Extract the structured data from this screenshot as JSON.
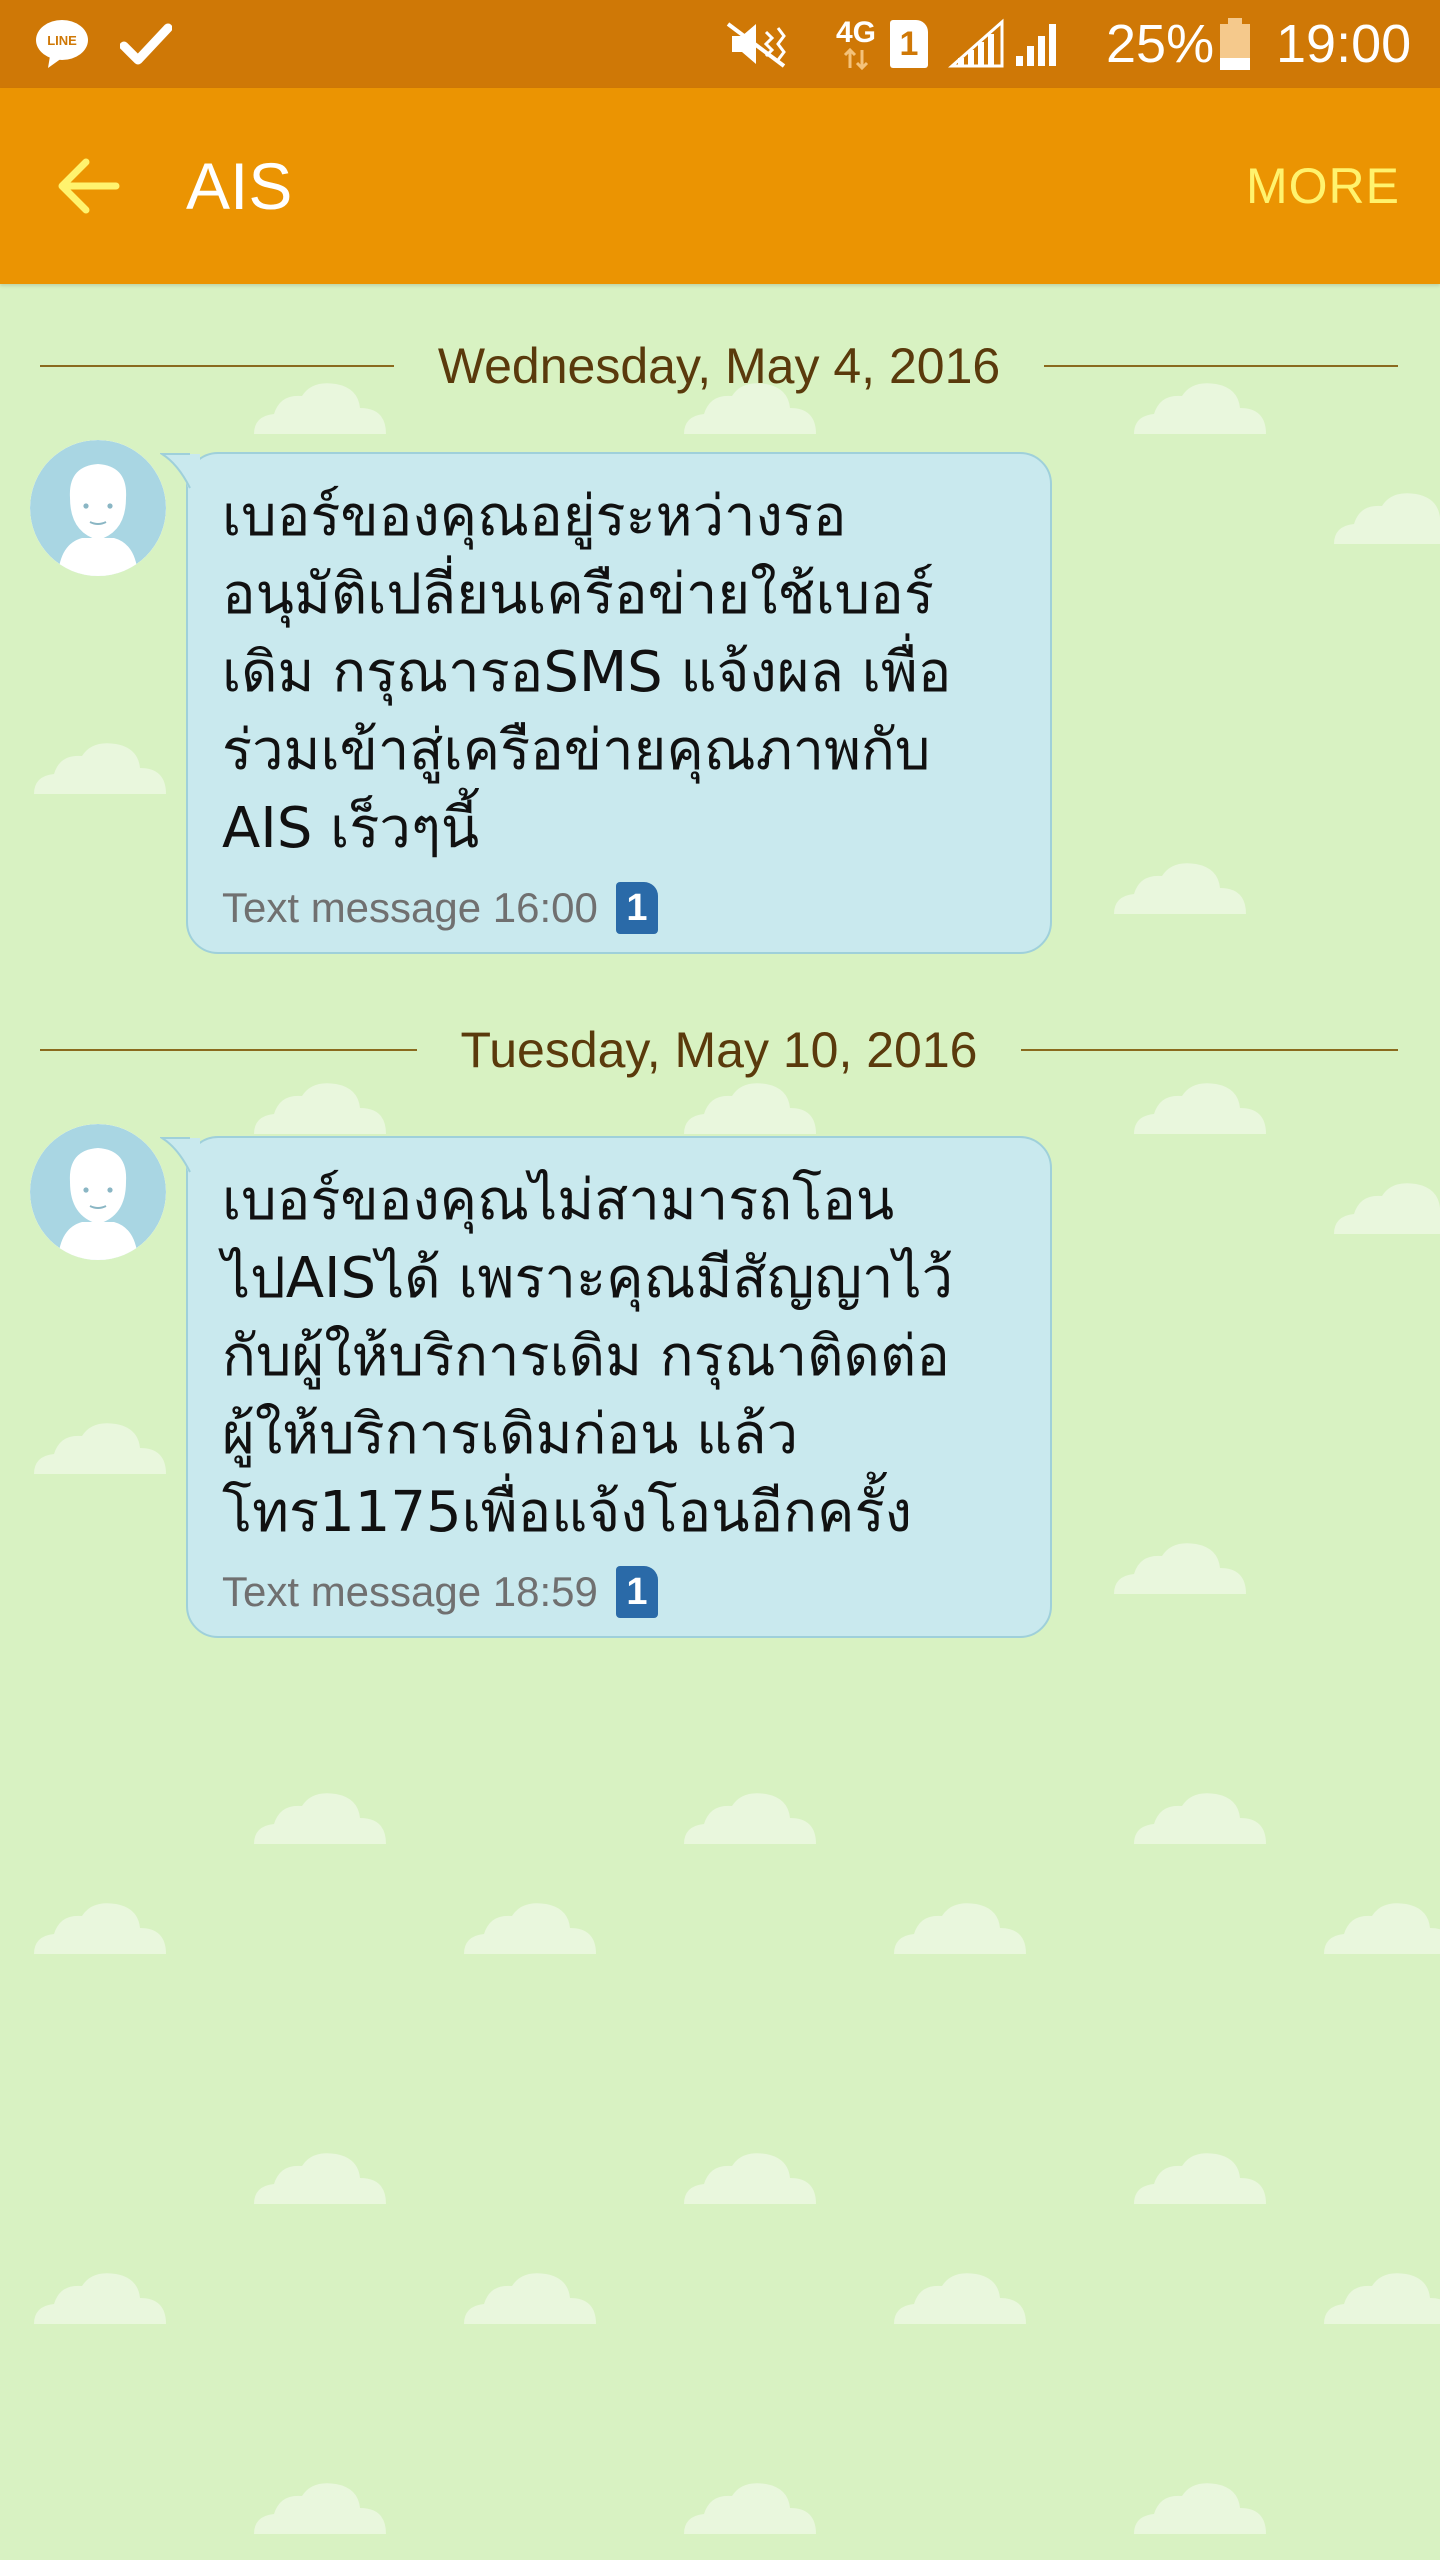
{
  "status_bar": {
    "left_icons": [
      "line-app-icon",
      "check-icon"
    ],
    "right_icons": [
      "vibrate-mute-icon",
      "4g-data-icon",
      "sim-1-icon",
      "signal-icon-sim1",
      "signal-icon-sim2",
      "battery-icon"
    ],
    "network_label": "4G",
    "sim_label": "1",
    "battery_percent": "25%",
    "battery_level": 0.25,
    "time": "19:00"
  },
  "app_bar": {
    "title": "AIS",
    "more_label": "MORE",
    "back_icon": "back-arrow-icon",
    "more_color": "#fff36e"
  },
  "colors": {
    "status_bar": "#cf7806",
    "app_bar": "#eb9402",
    "background": "#d8f2c2",
    "bubble": "#c9e9ee",
    "sim_badge": "#2a6aa8"
  },
  "conversation": {
    "groups": [
      {
        "date": "Wednesday, May 4, 2016",
        "message": {
          "text": "เบอร์ของคุณอยู่ระหว่างรอ\nอนุมัติเปลี่ยนเครือข่ายใช้เบอร์\nเดิม กรุณารอSMS แจ้งผล เพื่อ\nร่วมเข้าสู่เครือข่ายคุณภาพกับ\nAIS เร็วๆนี้",
          "meta": "Text message 16:00",
          "sim": "1"
        }
      },
      {
        "date": "Tuesday, May 10, 2016",
        "message": {
          "text": "เบอร์ของคุณไม่สามารถโอน\nไปAISได้ เพราะคุณมีสัญญาไว้\nกับผู้ให้บริการเดิม กรุณาติดต่อ\nผู้ให้บริการเดิมก่อน แล้ว\nโทร1175เพื่อแจ้งโอนอีกครั้ง",
          "meta": "Text message 18:59",
          "sim": "1"
        }
      }
    ]
  }
}
